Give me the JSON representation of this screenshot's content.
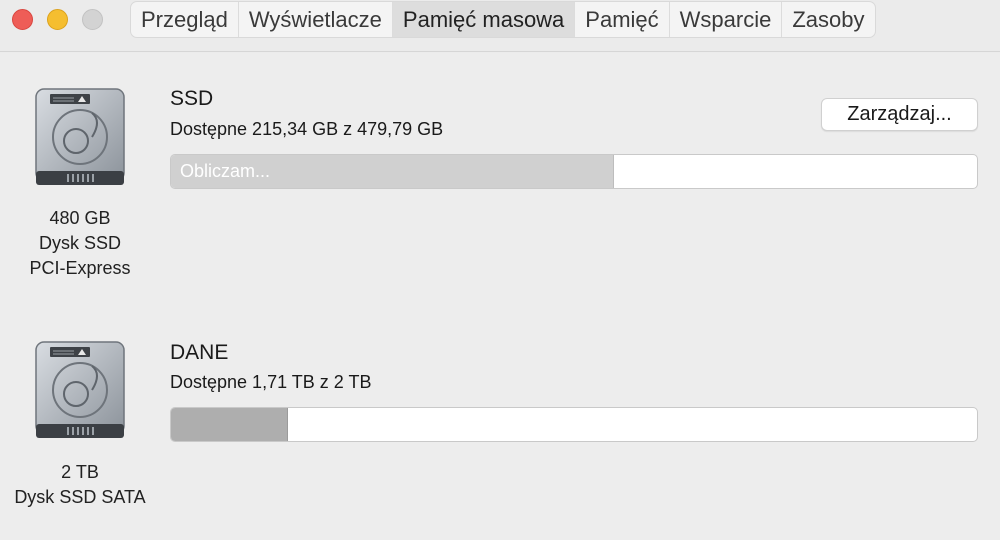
{
  "window": {
    "traffic_lights": [
      "close",
      "minimize",
      "zoom"
    ]
  },
  "tabs": [
    {
      "label": "Przegląd",
      "active": false
    },
    {
      "label": "Wyświetlacze",
      "active": false
    },
    {
      "label": "Pamięć masowa",
      "active": true
    },
    {
      "label": "Pamięć",
      "active": false
    },
    {
      "label": "Wsparcie",
      "active": false
    },
    {
      "label": "Zasoby",
      "active": false
    }
  ],
  "drives": [
    {
      "icon": "hard-drive-icon",
      "size": "480 GB",
      "type": "Dysk SSD",
      "interface": "PCI-Express",
      "volume_name": "SSD",
      "available": "Dostępne 215,34 GB z 479,79 GB",
      "used_fraction": 0.55,
      "bar_label": "Obliczam...",
      "manage_button": "Zarządzaj..."
    },
    {
      "icon": "hard-drive-icon",
      "size": "2 TB",
      "type": "Dysk SSD SATA",
      "volume_name": "DANE",
      "available": "Dostępne 1,71 TB z 2 TB",
      "used_fraction": 0.145
    }
  ],
  "colors": {
    "close": "#ee5d57",
    "minimize": "#f5be30",
    "zoom": "#d3d3d3",
    "bar_fill_calculating": "#d0d0d0",
    "bar_fill_used": "#aeaeae"
  }
}
